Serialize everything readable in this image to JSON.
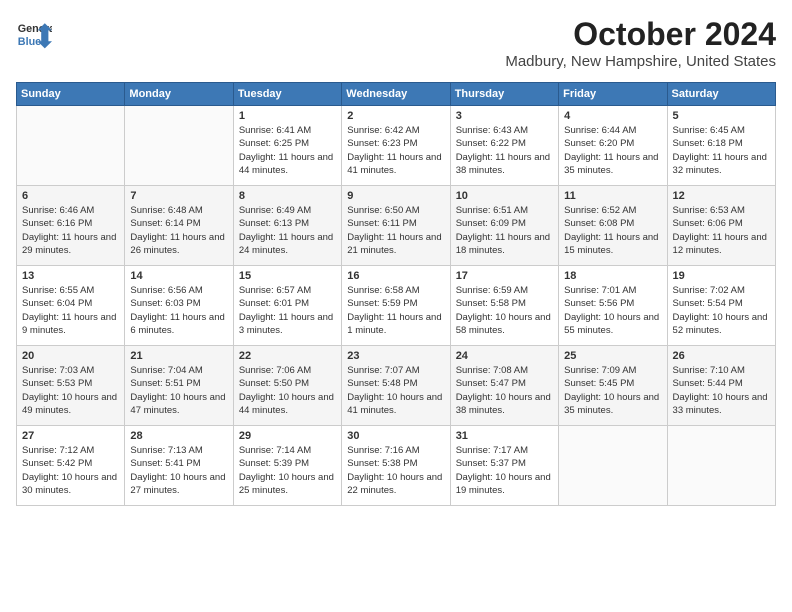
{
  "header": {
    "logo_line1": "General",
    "logo_line2": "Blue",
    "month_title": "October 2024",
    "location": "Madbury, New Hampshire, United States"
  },
  "weekdays": [
    "Sunday",
    "Monday",
    "Tuesday",
    "Wednesday",
    "Thursday",
    "Friday",
    "Saturday"
  ],
  "weeks": [
    [
      {
        "day": "",
        "sunrise": "",
        "sunset": "",
        "daylight": ""
      },
      {
        "day": "",
        "sunrise": "",
        "sunset": "",
        "daylight": ""
      },
      {
        "day": "1",
        "sunrise": "Sunrise: 6:41 AM",
        "sunset": "Sunset: 6:25 PM",
        "daylight": "Daylight: 11 hours and 44 minutes."
      },
      {
        "day": "2",
        "sunrise": "Sunrise: 6:42 AM",
        "sunset": "Sunset: 6:23 PM",
        "daylight": "Daylight: 11 hours and 41 minutes."
      },
      {
        "day": "3",
        "sunrise": "Sunrise: 6:43 AM",
        "sunset": "Sunset: 6:22 PM",
        "daylight": "Daylight: 11 hours and 38 minutes."
      },
      {
        "day": "4",
        "sunrise": "Sunrise: 6:44 AM",
        "sunset": "Sunset: 6:20 PM",
        "daylight": "Daylight: 11 hours and 35 minutes."
      },
      {
        "day": "5",
        "sunrise": "Sunrise: 6:45 AM",
        "sunset": "Sunset: 6:18 PM",
        "daylight": "Daylight: 11 hours and 32 minutes."
      }
    ],
    [
      {
        "day": "6",
        "sunrise": "Sunrise: 6:46 AM",
        "sunset": "Sunset: 6:16 PM",
        "daylight": "Daylight: 11 hours and 29 minutes."
      },
      {
        "day": "7",
        "sunrise": "Sunrise: 6:48 AM",
        "sunset": "Sunset: 6:14 PM",
        "daylight": "Daylight: 11 hours and 26 minutes."
      },
      {
        "day": "8",
        "sunrise": "Sunrise: 6:49 AM",
        "sunset": "Sunset: 6:13 PM",
        "daylight": "Daylight: 11 hours and 24 minutes."
      },
      {
        "day": "9",
        "sunrise": "Sunrise: 6:50 AM",
        "sunset": "Sunset: 6:11 PM",
        "daylight": "Daylight: 11 hours and 21 minutes."
      },
      {
        "day": "10",
        "sunrise": "Sunrise: 6:51 AM",
        "sunset": "Sunset: 6:09 PM",
        "daylight": "Daylight: 11 hours and 18 minutes."
      },
      {
        "day": "11",
        "sunrise": "Sunrise: 6:52 AM",
        "sunset": "Sunset: 6:08 PM",
        "daylight": "Daylight: 11 hours and 15 minutes."
      },
      {
        "day": "12",
        "sunrise": "Sunrise: 6:53 AM",
        "sunset": "Sunset: 6:06 PM",
        "daylight": "Daylight: 11 hours and 12 minutes."
      }
    ],
    [
      {
        "day": "13",
        "sunrise": "Sunrise: 6:55 AM",
        "sunset": "Sunset: 6:04 PM",
        "daylight": "Daylight: 11 hours and 9 minutes."
      },
      {
        "day": "14",
        "sunrise": "Sunrise: 6:56 AM",
        "sunset": "Sunset: 6:03 PM",
        "daylight": "Daylight: 11 hours and 6 minutes."
      },
      {
        "day": "15",
        "sunrise": "Sunrise: 6:57 AM",
        "sunset": "Sunset: 6:01 PM",
        "daylight": "Daylight: 11 hours and 3 minutes."
      },
      {
        "day": "16",
        "sunrise": "Sunrise: 6:58 AM",
        "sunset": "Sunset: 5:59 PM",
        "daylight": "Daylight: 11 hours and 1 minute."
      },
      {
        "day": "17",
        "sunrise": "Sunrise: 6:59 AM",
        "sunset": "Sunset: 5:58 PM",
        "daylight": "Daylight: 10 hours and 58 minutes."
      },
      {
        "day": "18",
        "sunrise": "Sunrise: 7:01 AM",
        "sunset": "Sunset: 5:56 PM",
        "daylight": "Daylight: 10 hours and 55 minutes."
      },
      {
        "day": "19",
        "sunrise": "Sunrise: 7:02 AM",
        "sunset": "Sunset: 5:54 PM",
        "daylight": "Daylight: 10 hours and 52 minutes."
      }
    ],
    [
      {
        "day": "20",
        "sunrise": "Sunrise: 7:03 AM",
        "sunset": "Sunset: 5:53 PM",
        "daylight": "Daylight: 10 hours and 49 minutes."
      },
      {
        "day": "21",
        "sunrise": "Sunrise: 7:04 AM",
        "sunset": "Sunset: 5:51 PM",
        "daylight": "Daylight: 10 hours and 47 minutes."
      },
      {
        "day": "22",
        "sunrise": "Sunrise: 7:06 AM",
        "sunset": "Sunset: 5:50 PM",
        "daylight": "Daylight: 10 hours and 44 minutes."
      },
      {
        "day": "23",
        "sunrise": "Sunrise: 7:07 AM",
        "sunset": "Sunset: 5:48 PM",
        "daylight": "Daylight: 10 hours and 41 minutes."
      },
      {
        "day": "24",
        "sunrise": "Sunrise: 7:08 AM",
        "sunset": "Sunset: 5:47 PM",
        "daylight": "Daylight: 10 hours and 38 minutes."
      },
      {
        "day": "25",
        "sunrise": "Sunrise: 7:09 AM",
        "sunset": "Sunset: 5:45 PM",
        "daylight": "Daylight: 10 hours and 35 minutes."
      },
      {
        "day": "26",
        "sunrise": "Sunrise: 7:10 AM",
        "sunset": "Sunset: 5:44 PM",
        "daylight": "Daylight: 10 hours and 33 minutes."
      }
    ],
    [
      {
        "day": "27",
        "sunrise": "Sunrise: 7:12 AM",
        "sunset": "Sunset: 5:42 PM",
        "daylight": "Daylight: 10 hours and 30 minutes."
      },
      {
        "day": "28",
        "sunrise": "Sunrise: 7:13 AM",
        "sunset": "Sunset: 5:41 PM",
        "daylight": "Daylight: 10 hours and 27 minutes."
      },
      {
        "day": "29",
        "sunrise": "Sunrise: 7:14 AM",
        "sunset": "Sunset: 5:39 PM",
        "daylight": "Daylight: 10 hours and 25 minutes."
      },
      {
        "day": "30",
        "sunrise": "Sunrise: 7:16 AM",
        "sunset": "Sunset: 5:38 PM",
        "daylight": "Daylight: 10 hours and 22 minutes."
      },
      {
        "day": "31",
        "sunrise": "Sunrise: 7:17 AM",
        "sunset": "Sunset: 5:37 PM",
        "daylight": "Daylight: 10 hours and 19 minutes."
      },
      {
        "day": "",
        "sunrise": "",
        "sunset": "",
        "daylight": ""
      },
      {
        "day": "",
        "sunrise": "",
        "sunset": "",
        "daylight": ""
      }
    ]
  ]
}
